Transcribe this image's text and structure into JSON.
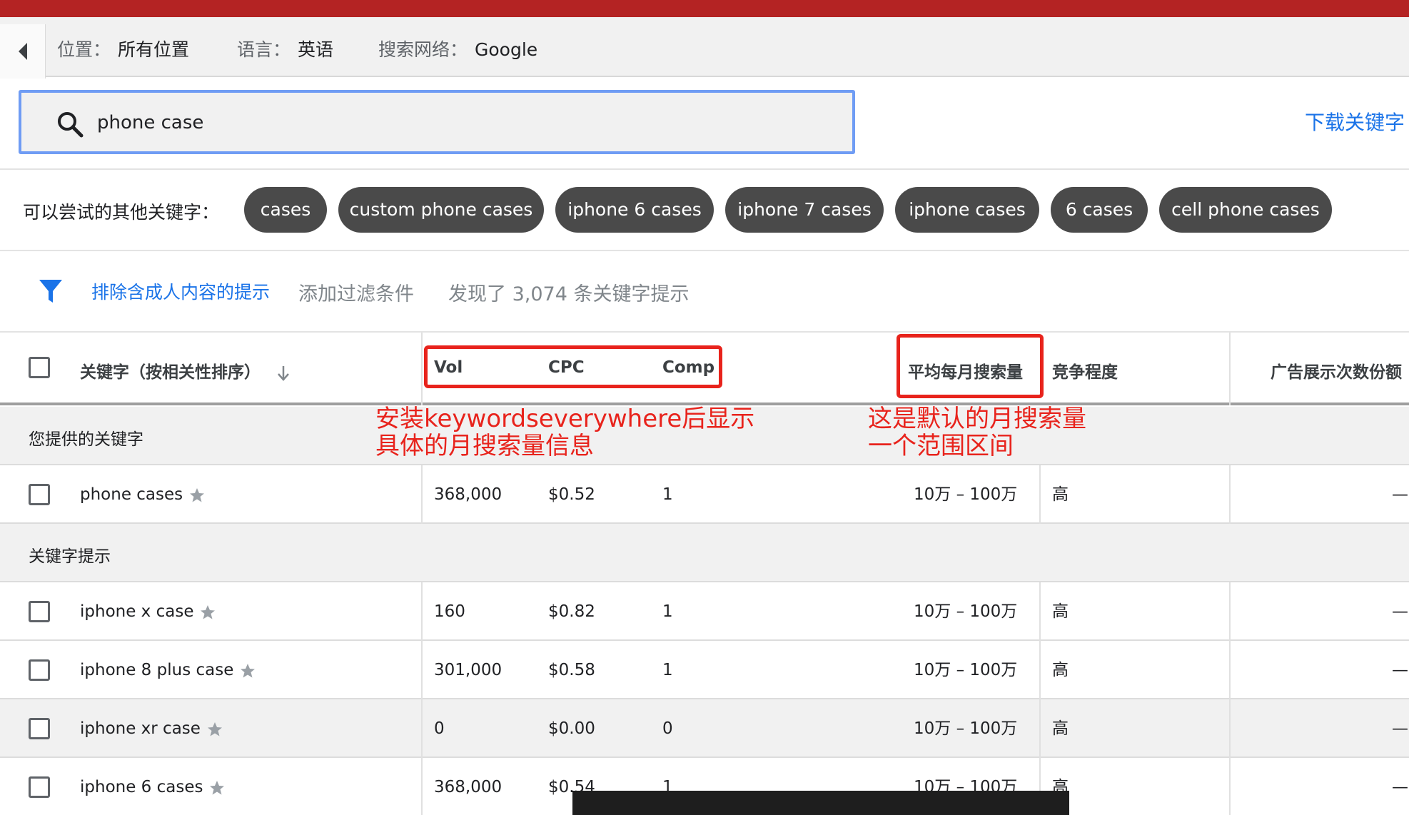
{
  "location_bar": {
    "location_label": "位置：",
    "location_value": "所有位置",
    "language_label": "语言：",
    "language_value": "英语",
    "network_label": "搜索网络：",
    "network_value": "Google"
  },
  "search": {
    "value": "phone case"
  },
  "download_link": "下载关键字",
  "suggestions": {
    "label": "可以尝试的其他关键字：",
    "chips": [
      "cases",
      "custom phone cases",
      "iphone 6 cases",
      "iphone 7 cases",
      "iphone cases",
      "6 cases",
      "cell phone cases"
    ]
  },
  "filter": {
    "exclude_adult": "排除含成人内容的提示",
    "add_filter": "添加过滤条件",
    "result_count": "发现了 3,074 条关键字提示"
  },
  "table": {
    "headers": {
      "keyword": "关键字（按相关性排序）",
      "vol": "Vol",
      "cpc": "CPC",
      "comp": "Comp",
      "avg_monthly": "平均每月搜索量",
      "competition": "竞争程度",
      "impression_share": "广告展示次数份额"
    },
    "group_provided": "您提供的关键字",
    "group_suggested": "关键字提示",
    "provided_rows": [
      {
        "keyword": "phone cases",
        "vol": "368,000",
        "cpc": "$0.52",
        "comp": "1",
        "range": "10万 – 100万",
        "competition": "高",
        "share": "—"
      }
    ],
    "suggested_rows": [
      {
        "keyword": "iphone x case",
        "vol": "160",
        "cpc": "$0.82",
        "comp": "1",
        "range": "10万 – 100万",
        "competition": "高",
        "share": "—"
      },
      {
        "keyword": "iphone 8 plus case",
        "vol": "301,000",
        "cpc": "$0.58",
        "comp": "1",
        "range": "10万 – 100万",
        "competition": "高",
        "share": "—"
      },
      {
        "keyword": "iphone xr case",
        "vol": "0",
        "cpc": "$0.00",
        "comp": "0",
        "range": "10万 – 100万",
        "competition": "高",
        "share": "—"
      },
      {
        "keyword": "iphone 6 cases",
        "vol": "368,000",
        "cpc": "$0.54",
        "comp": "1",
        "range": "10万 – 100万",
        "competition": "高",
        "share": "—"
      }
    ]
  },
  "annotations": {
    "left_line1": "安装keywordseverywhere后显示",
    "left_line2": "具体的月搜索量信息",
    "right_line1": "这是默认的月搜索量",
    "right_line2": "一个范围区间"
  },
  "colors": {
    "top_bar": "#b42323",
    "chip_bg": "#4a4a4a",
    "link_blue": "#1a73e8",
    "annotation_red": "#e8231c",
    "search_border": "#6f9cf4"
  },
  "icons": {
    "back": "back-arrow-icon",
    "search": "search-icon",
    "filter": "filter-funnel-icon",
    "sort": "sort-down-arrow-icon",
    "star": "star-icon"
  }
}
